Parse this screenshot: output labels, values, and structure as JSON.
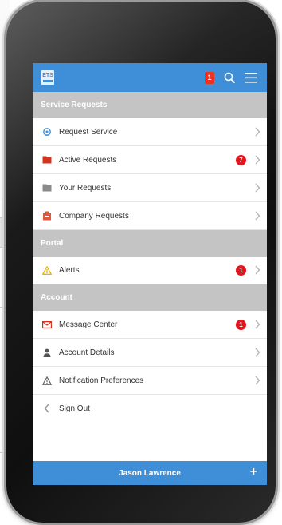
{
  "app": {
    "logo_text": "ETS",
    "notification_count": "1"
  },
  "sections": [
    {
      "title": "Service Requests",
      "items": [
        {
          "label": "Request Service",
          "icon": "service-bell-icon",
          "count": null
        },
        {
          "label": "Active Requests",
          "icon": "folder-red-icon",
          "count": "7"
        },
        {
          "label": "Your Requests",
          "icon": "folder-gray-icon",
          "count": null
        },
        {
          "label": "Company Requests",
          "icon": "building-icon",
          "count": null
        }
      ]
    },
    {
      "title": "Portal",
      "items": [
        {
          "label": "Alerts",
          "icon": "warning-icon",
          "count": "1"
        }
      ]
    },
    {
      "title": "Account",
      "items": [
        {
          "label": "Message Center",
          "icon": "envelope-icon",
          "count": "1"
        },
        {
          "label": "Account Details",
          "icon": "user-icon",
          "count": null
        },
        {
          "label": "Notification Preferences",
          "icon": "warning-outline-icon",
          "count": null
        },
        {
          "label": "Sign Out",
          "icon": "chevron-left-icon",
          "count": null
        }
      ]
    }
  ],
  "footer": {
    "user_name": "Jason Lawrence",
    "plus_label": "+"
  },
  "colors": {
    "brand_blue": "#3f8fd8",
    "section_gray": "#c4c4c4",
    "badge_red": "#e3141b"
  }
}
